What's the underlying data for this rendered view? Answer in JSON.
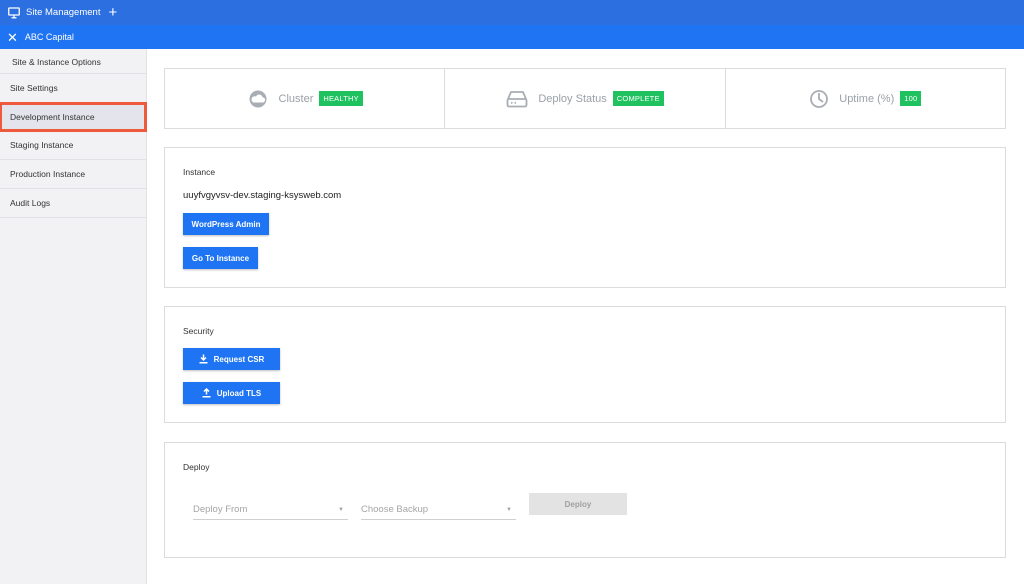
{
  "topbar": {
    "title": "Site Management",
    "add_icon": "plus-icon",
    "app_icon": "monitor-icon"
  },
  "subbar": {
    "title": "ABC Capital",
    "close_icon": "close-icon"
  },
  "sidebar": {
    "header": "Site & Instance Options",
    "items": [
      {
        "label": "Site Settings",
        "active": false
      },
      {
        "label": "Development Instance",
        "active": true
      },
      {
        "label": "Staging Instance",
        "active": false
      },
      {
        "label": "Production Instance",
        "active": false
      },
      {
        "label": "Audit Logs",
        "active": false
      }
    ]
  },
  "stats": [
    {
      "label": "Cluster",
      "badge": "HEALTHY",
      "icon": "cloud-icon"
    },
    {
      "label": "Deploy Status",
      "badge": "COMPLETE",
      "icon": "hard-drive-icon"
    },
    {
      "label": "Uptime (%)",
      "badge": "100",
      "icon": "timer-icon"
    }
  ],
  "instance": {
    "title": "Instance",
    "hostname": "uuyfvgyvsv-dev.staging-ksysweb.com",
    "wp_admin_label": "WordPress Admin",
    "go_to_label": "Go To Instance"
  },
  "security": {
    "title": "Security",
    "request_csr_label": "Request CSR",
    "upload_tls_label": "Upload TLS"
  },
  "deploy": {
    "title": "Deploy",
    "deploy_from_placeholder": "Deploy From",
    "choose_backup_placeholder": "Choose Backup",
    "deploy_label": "Deploy"
  },
  "colors": {
    "primary": "#1e74f2",
    "success": "#1fc25f",
    "highlight": "#ef5a3c"
  }
}
